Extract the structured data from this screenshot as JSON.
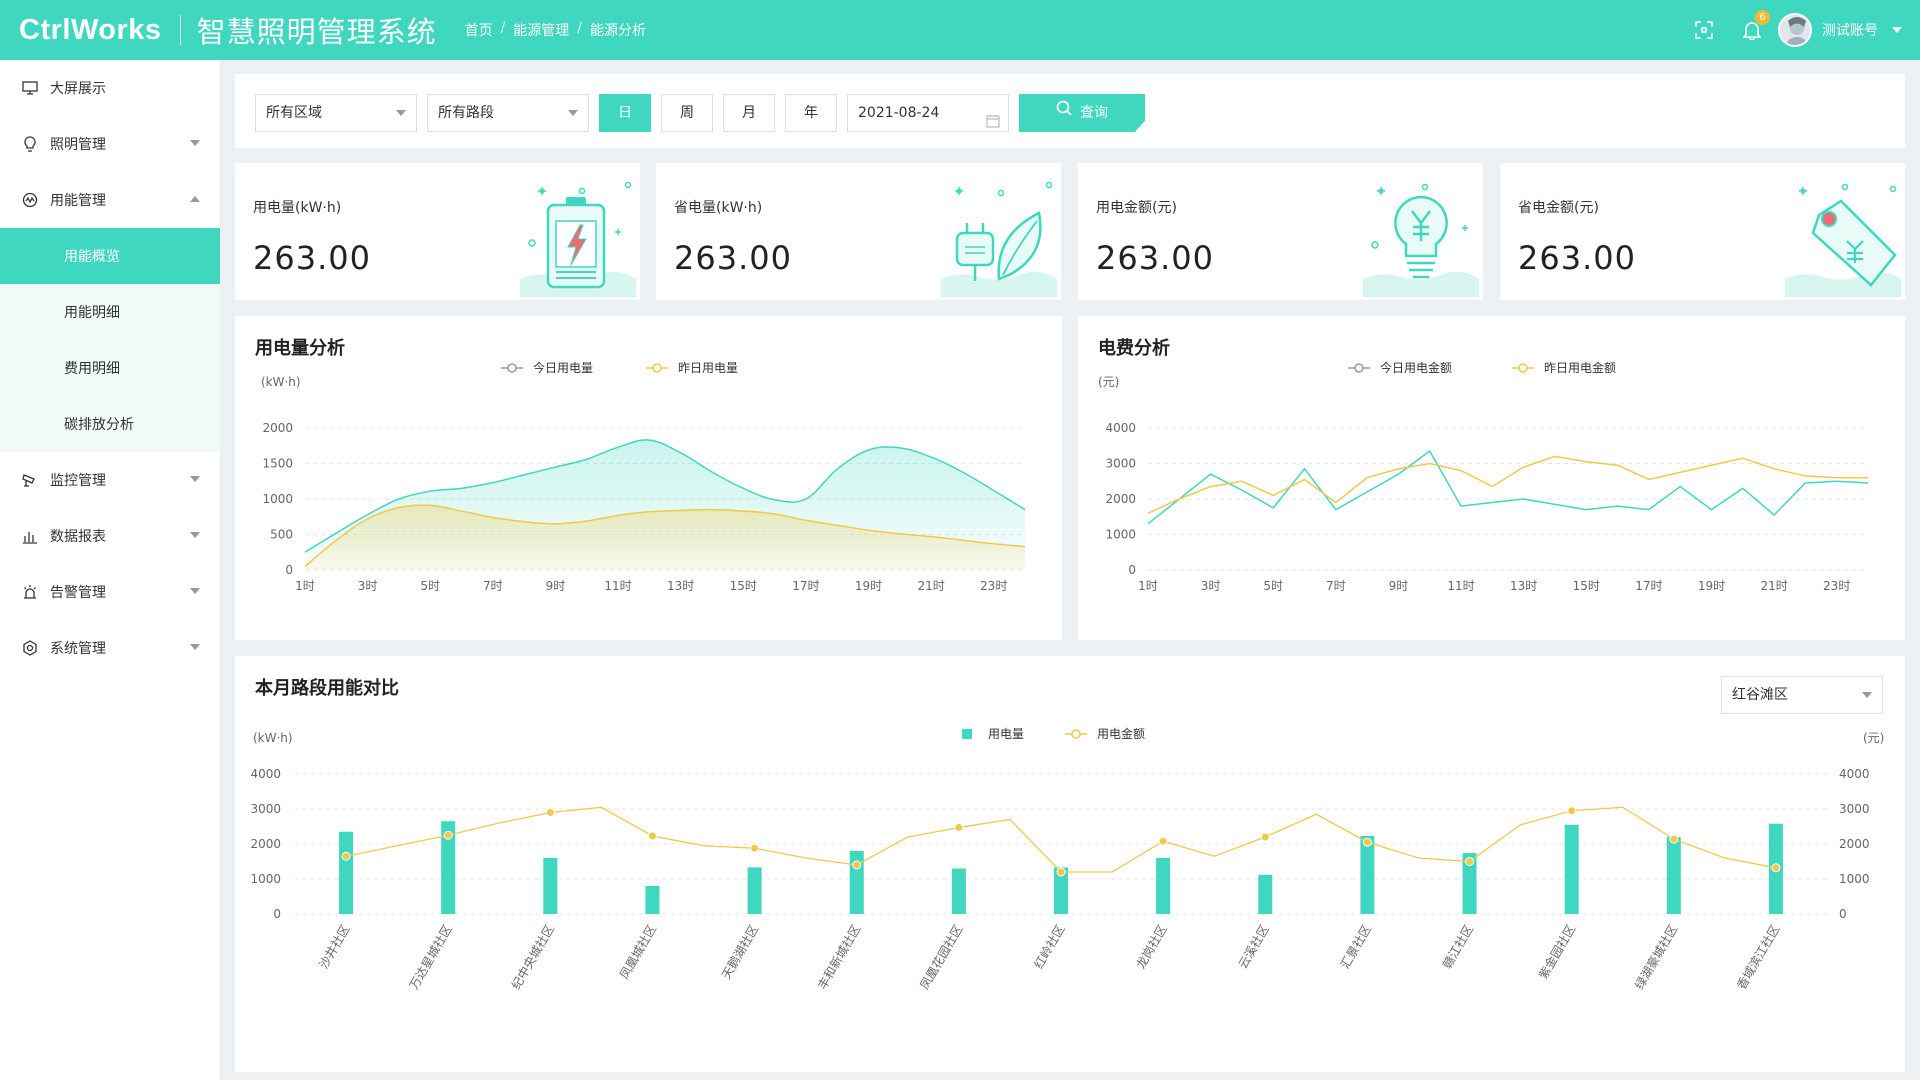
{
  "header": {
    "logo": "CtrlWorks",
    "system_title": "智慧照明管理系统",
    "breadcrumb": [
      "首页",
      "能源管理",
      "能源分析"
    ],
    "notification_count": "6",
    "user_name": "测试账号"
  },
  "sidebar": {
    "items": [
      {
        "label": "大屏展示",
        "icon": "monitor-icon"
      },
      {
        "label": "照明管理",
        "icon": "bulb-icon"
      },
      {
        "label": "用能管理",
        "icon": "energy-icon",
        "expanded": true,
        "children": [
          {
            "label": "用能概览",
            "active": true
          },
          {
            "label": "用能明细"
          },
          {
            "label": "费用明细"
          },
          {
            "label": "碳排放分析"
          }
        ]
      },
      {
        "label": "监控管理",
        "icon": "camera-icon"
      },
      {
        "label": "数据报表",
        "icon": "bar-chart-icon"
      },
      {
        "label": "告警管理",
        "icon": "alarm-icon"
      },
      {
        "label": "系统管理",
        "icon": "settings-icon"
      }
    ]
  },
  "filters": {
    "area": "所有区域",
    "road": "所有路段",
    "periods": [
      "日",
      "周",
      "月",
      "年"
    ],
    "active_period": "日",
    "date": "2021-08-24",
    "query_label": "查询"
  },
  "stats": [
    {
      "label": "用电量(kW·h)",
      "value": "263.00",
      "icon": "battery-icon"
    },
    {
      "label": "省电量(kW·h)",
      "value": "263.00",
      "icon": "plug-leaf-icon"
    },
    {
      "label": "用电金额(元)",
      "value": "263.00",
      "icon": "yuan-bulb-icon"
    },
    {
      "label": "省电金额(元)",
      "value": "263.00",
      "icon": "yuan-tag-icon"
    }
  ],
  "colors": {
    "accent": "#3fd7bf",
    "line_today": "#3fd7bf",
    "line_yesterday": "#f0c94a"
  },
  "chart_data": [
    {
      "type": "area",
      "title": "用电量分析",
      "ylabel": "(kW·h)",
      "ylim": [
        0,
        2000
      ],
      "yticks": [
        0,
        500,
        1000,
        1500,
        2000
      ],
      "x": [
        "1时",
        "2时",
        "3时",
        "4时",
        "5时",
        "6时",
        "7时",
        "8时",
        "9时",
        "10时",
        "11时",
        "12时",
        "13时",
        "14时",
        "15时",
        "16时",
        "17时",
        "18时",
        "19时",
        "20时",
        "21时",
        "22时",
        "23时",
        "24时"
      ],
      "xtick_labels": [
        "1时",
        "3时",
        "5时",
        "7时",
        "9时",
        "11时",
        "13时",
        "15时",
        "17时",
        "19时",
        "21时",
        "23时"
      ],
      "series": [
        {
          "name": "今日用电量",
          "values": [
            250,
            520,
            780,
            1000,
            1110,
            1150,
            1230,
            1340,
            1450,
            1560,
            1730,
            1830,
            1650,
            1380,
            1150,
            990,
            1000,
            1420,
            1690,
            1720,
            1590,
            1380,
            1120,
            850
          ]
        },
        {
          "name": "昨日用电量",
          "values": [
            50,
            420,
            720,
            880,
            910,
            830,
            740,
            680,
            650,
            690,
            770,
            820,
            840,
            850,
            830,
            790,
            700,
            630,
            560,
            510,
            470,
            420,
            370,
            330
          ]
        }
      ],
      "legend": "top-center",
      "grid": true
    },
    {
      "type": "line",
      "title": "电费分析",
      "ylabel": "(元)",
      "ylim": [
        0,
        4000
      ],
      "yticks": [
        0,
        1000,
        2000,
        3000,
        4000
      ],
      "x": [
        "1时",
        "2时",
        "3时",
        "4时",
        "5时",
        "6时",
        "7时",
        "8时",
        "9时",
        "10时",
        "11时",
        "12时",
        "13时",
        "14时",
        "15时",
        "16时",
        "17时",
        "18时",
        "19时",
        "20时",
        "21时",
        "22时",
        "23时",
        "24时"
      ],
      "xtick_labels": [
        "1时",
        "3时",
        "5时",
        "7时",
        "9时",
        "11时",
        "13时",
        "15时",
        "17时",
        "19时",
        "21时",
        "23时"
      ],
      "series": [
        {
          "name": "今日用电金额",
          "values": [
            1300,
            2000,
            2700,
            2250,
            1750,
            2850,
            1700,
            2200,
            2700,
            3350,
            1800,
            1900,
            2000,
            1850,
            1700,
            1800,
            1700,
            2350,
            1700,
            2300,
            1550,
            2450,
            2500,
            2450
          ]
        },
        {
          "name": "昨日用电金额",
          "values": [
            1600,
            2000,
            2350,
            2500,
            2100,
            2550,
            1900,
            2600,
            2850,
            3000,
            2800,
            2350,
            2900,
            3200,
            3050,
            2950,
            2550,
            2750,
            2950,
            3150,
            2850,
            2650,
            2600,
            2600
          ]
        }
      ],
      "legend": "top-center",
      "grid": true
    },
    {
      "type": "bar",
      "title": "本月路段用能对比",
      "region": "红谷滩区",
      "ylabel_left": "(kW·h)",
      "ylabel_right": "(元)",
      "ylim": [
        0,
        4000
      ],
      "yticks": [
        0,
        1000,
        2000,
        3000,
        4000
      ],
      "categories": [
        "沙井社区",
        "万达星城社区",
        "纪中央城社区",
        "凤凰城社区",
        "天鹅湖社区",
        "丰和新城社区",
        "凤凰花园社区",
        "红岭社区",
        "龙岗社区",
        "云溪社区",
        "汇景社区",
        "赣江社区",
        "紫金园社区",
        "绿湖豪城社区",
        "香域滨江社区"
      ],
      "series": [
        {
          "name": "用电量",
          "type": "bar",
          "values": [
            2350,
            2650,
            1600,
            800,
            1330,
            1800,
            1300,
            1330,
            1600,
            1120,
            2230,
            1740,
            2550,
            2200,
            2580
          ]
        },
        {
          "name": "用电金额",
          "type": "line",
          "values": [
            1650,
            2250,
            2900,
            2230,
            1880,
            1400,
            2470,
            1200,
            2080,
            2200,
            2050,
            1500,
            2950,
            2140,
            1320
          ],
          "mid_values": [
            1950,
            2600,
            3050,
            1950,
            1600,
            2200,
            2700,
            1200,
            1650,
            2850,
            1600,
            2550,
            3050,
            1600,
            1300
          ]
        }
      ],
      "legend": "top-center",
      "grid": true
    }
  ]
}
